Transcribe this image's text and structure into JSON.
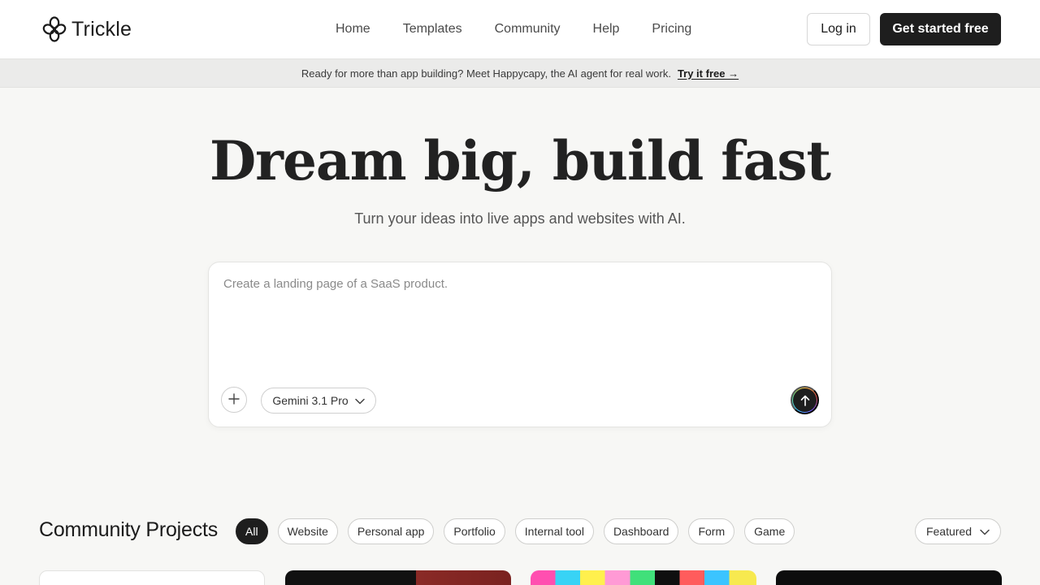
{
  "brand": {
    "name": "Trickle",
    "icon": "flower-logo-icon"
  },
  "nav": {
    "items": [
      "Home",
      "Templates",
      "Community",
      "Help",
      "Pricing"
    ]
  },
  "auth": {
    "login_label": "Log in",
    "signup_label": "Get started free"
  },
  "banner": {
    "text": "Ready for more than app building? Meet Happycapy, the AI agent for real work.",
    "link_label": "Try it free →"
  },
  "hero": {
    "title": "Dream big, build fast",
    "subtitle": "Turn your ideas into live apps and websites with AI."
  },
  "prompt": {
    "placeholder": "Create a landing page of a SaaS product.",
    "value": "",
    "model_label": "Gemini 3.1 Pro",
    "add_icon": "plus-icon",
    "model_icon": "chevron-down-icon",
    "send_icon": "arrow-up-icon"
  },
  "community": {
    "title": "Community Projects",
    "filters": [
      "All",
      "Website",
      "Personal app",
      "Portfolio",
      "Internal tool",
      "Dashboard",
      "Form",
      "Game"
    ],
    "active_filter": "All",
    "sort_label": "Featured"
  },
  "colors": {
    "primary": "#1e1e1e",
    "background": "#f7f7f5",
    "banner": "#ebebea"
  }
}
